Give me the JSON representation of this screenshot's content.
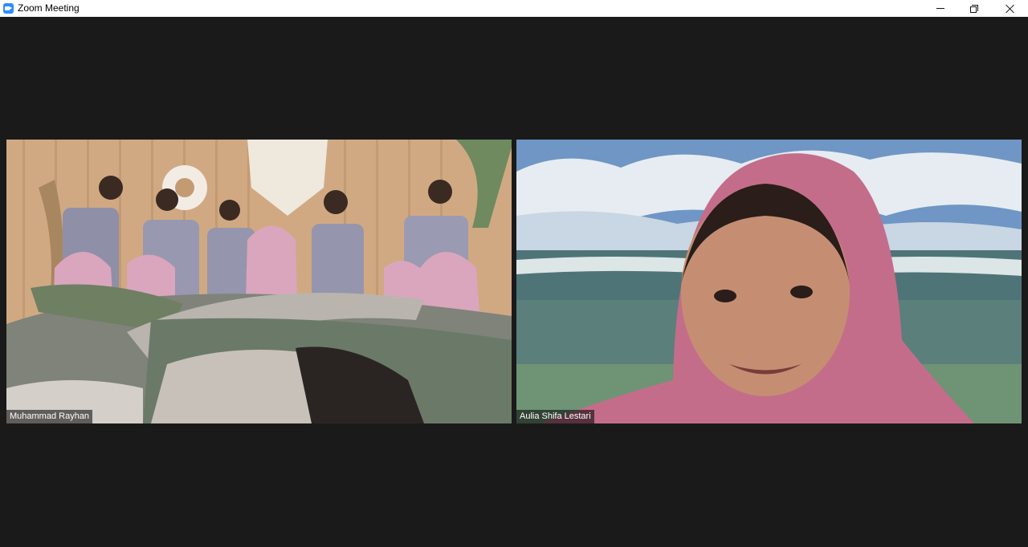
{
  "window": {
    "title": "Zoom Meeting",
    "controls": {
      "minimize": "minimize-icon",
      "restore": "restore-icon",
      "close": "close-icon"
    }
  },
  "meeting": {
    "background": "#1a1a1a",
    "participants": [
      {
        "name": "Muhammad Rayhan"
      },
      {
        "name": "Aulia Shifa Lestari"
      }
    ]
  },
  "colors": {
    "zoom_blue": "#2d8cff"
  }
}
